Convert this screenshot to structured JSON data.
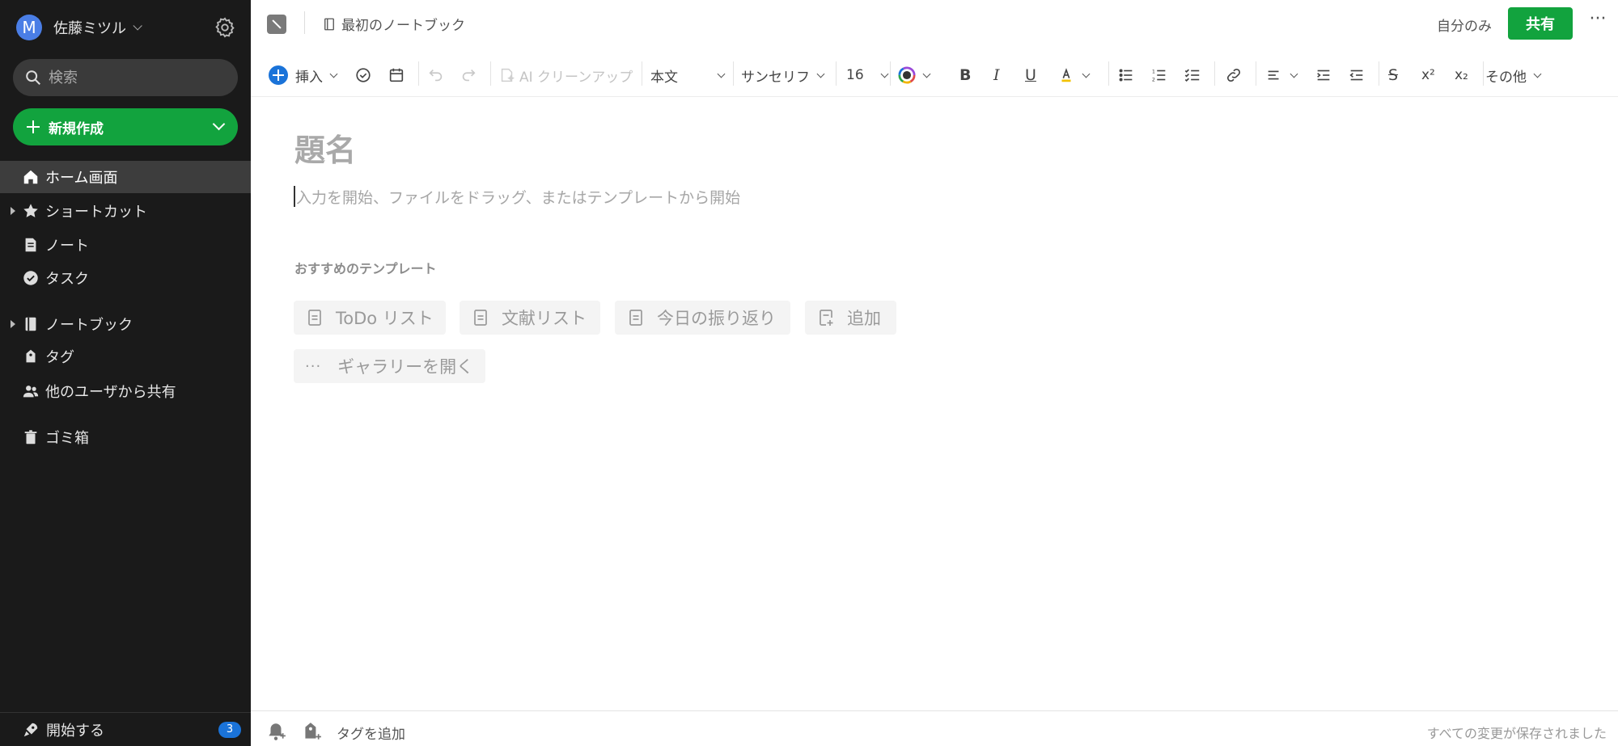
{
  "sidebar": {
    "account": {
      "initial": "M",
      "name": "佐藤ミツル"
    },
    "search_placeholder": "検索",
    "new_button": "新規作成",
    "nav": {
      "home": "ホーム画面",
      "shortcuts": "ショートカット",
      "notes": "ノート",
      "tasks": "タスク",
      "notebooks": "ノートブック",
      "tags": "タグ",
      "shared": "他のユーザから共有",
      "trash": "ゴミ箱"
    },
    "start": {
      "label": "開始する",
      "badge": "3"
    }
  },
  "header": {
    "notebook": "最初のノートブック",
    "visibility": "自分のみ",
    "share": "共有",
    "more": "···"
  },
  "toolbar": {
    "insert": "挿入",
    "ai_cleanup": "AI クリーンアップ",
    "style": "本文",
    "font": "サンセリフ",
    "size": "16",
    "more": "その他"
  },
  "editor": {
    "title_placeholder": "題名",
    "body_placeholder": "入力を開始、ファイルをドラッグ、またはテンプレートから開始",
    "templates_heading": "おすすめのテンプレート",
    "templates": [
      "ToDo リスト",
      "文献リスト",
      "今日の振り返り",
      "追加"
    ],
    "gallery": "ギャラリーを開く"
  },
  "footer": {
    "add_tag": "タグを追加",
    "save_status": "すべての変更が保存されました"
  },
  "colors": {
    "sidebar_bg": "#1a1a1a",
    "accent_green": "#12a33e",
    "accent_blue": "#1a73d9"
  }
}
